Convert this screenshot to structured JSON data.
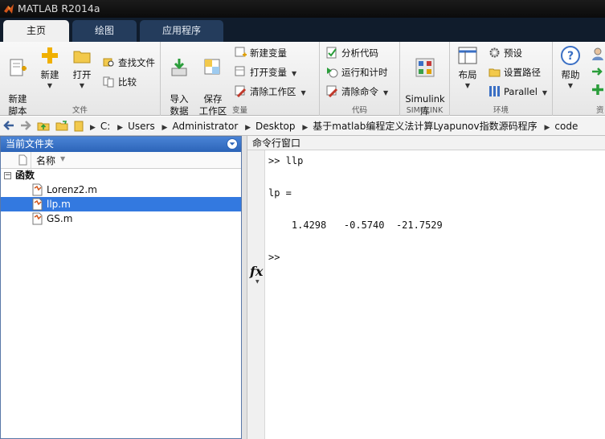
{
  "window": {
    "title": "MATLAB R2014a"
  },
  "tabs": [
    {
      "label": "主页"
    },
    {
      "label": "绘图"
    },
    {
      "label": "应用程序"
    }
  ],
  "ribbon": {
    "file": {
      "label": "文件",
      "new_script": "新建\n脚本",
      "new": "新建",
      "open": "打开",
      "find_files": "查找文件",
      "compare": "比较"
    },
    "variable": {
      "label": "变量",
      "import": "导入\n数据",
      "save_ws": "保存\n工作区",
      "new_var": "新建变量",
      "open_var": "打开变量",
      "clear_ws": "清除工作区"
    },
    "code": {
      "label": "代码",
      "analyze": "分析代码",
      "run_time": "运行和计时",
      "clear_cmds": "清除命令"
    },
    "simulink": {
      "label": "SIMULINK",
      "lib": "Simulink\n库"
    },
    "env": {
      "label": "环境",
      "layout": "布局",
      "prefs": "预设",
      "set_path": "设置路径",
      "parallel": "Parallel"
    },
    "resources": {
      "help": "帮助",
      "label_partial": "资"
    }
  },
  "address": {
    "crumbs": [
      "C:",
      "Users",
      "Administrator",
      "Desktop",
      "基于matlab编程定义法计算Lyapunov指数源码程序",
      "code"
    ]
  },
  "current_folder": {
    "title": "当前文件夹",
    "column_name": "名称",
    "group": "函数",
    "files": [
      {
        "name": "Lorenz2.m",
        "selected": false
      },
      {
        "name": "llp.m",
        "selected": true
      },
      {
        "name": "GS.m",
        "selected": false
      }
    ]
  },
  "command_window": {
    "title": "命令行窗口",
    "lines": [
      ">> llp",
      "lp =",
      "    1.4298   -0.5740  -21.7529"
    ],
    "prompt": ">>",
    "fx": "fx"
  },
  "colors": {
    "accent": "#3379e0",
    "tab_active": "#f0f0f0",
    "tabbar": "#101c2c"
  }
}
